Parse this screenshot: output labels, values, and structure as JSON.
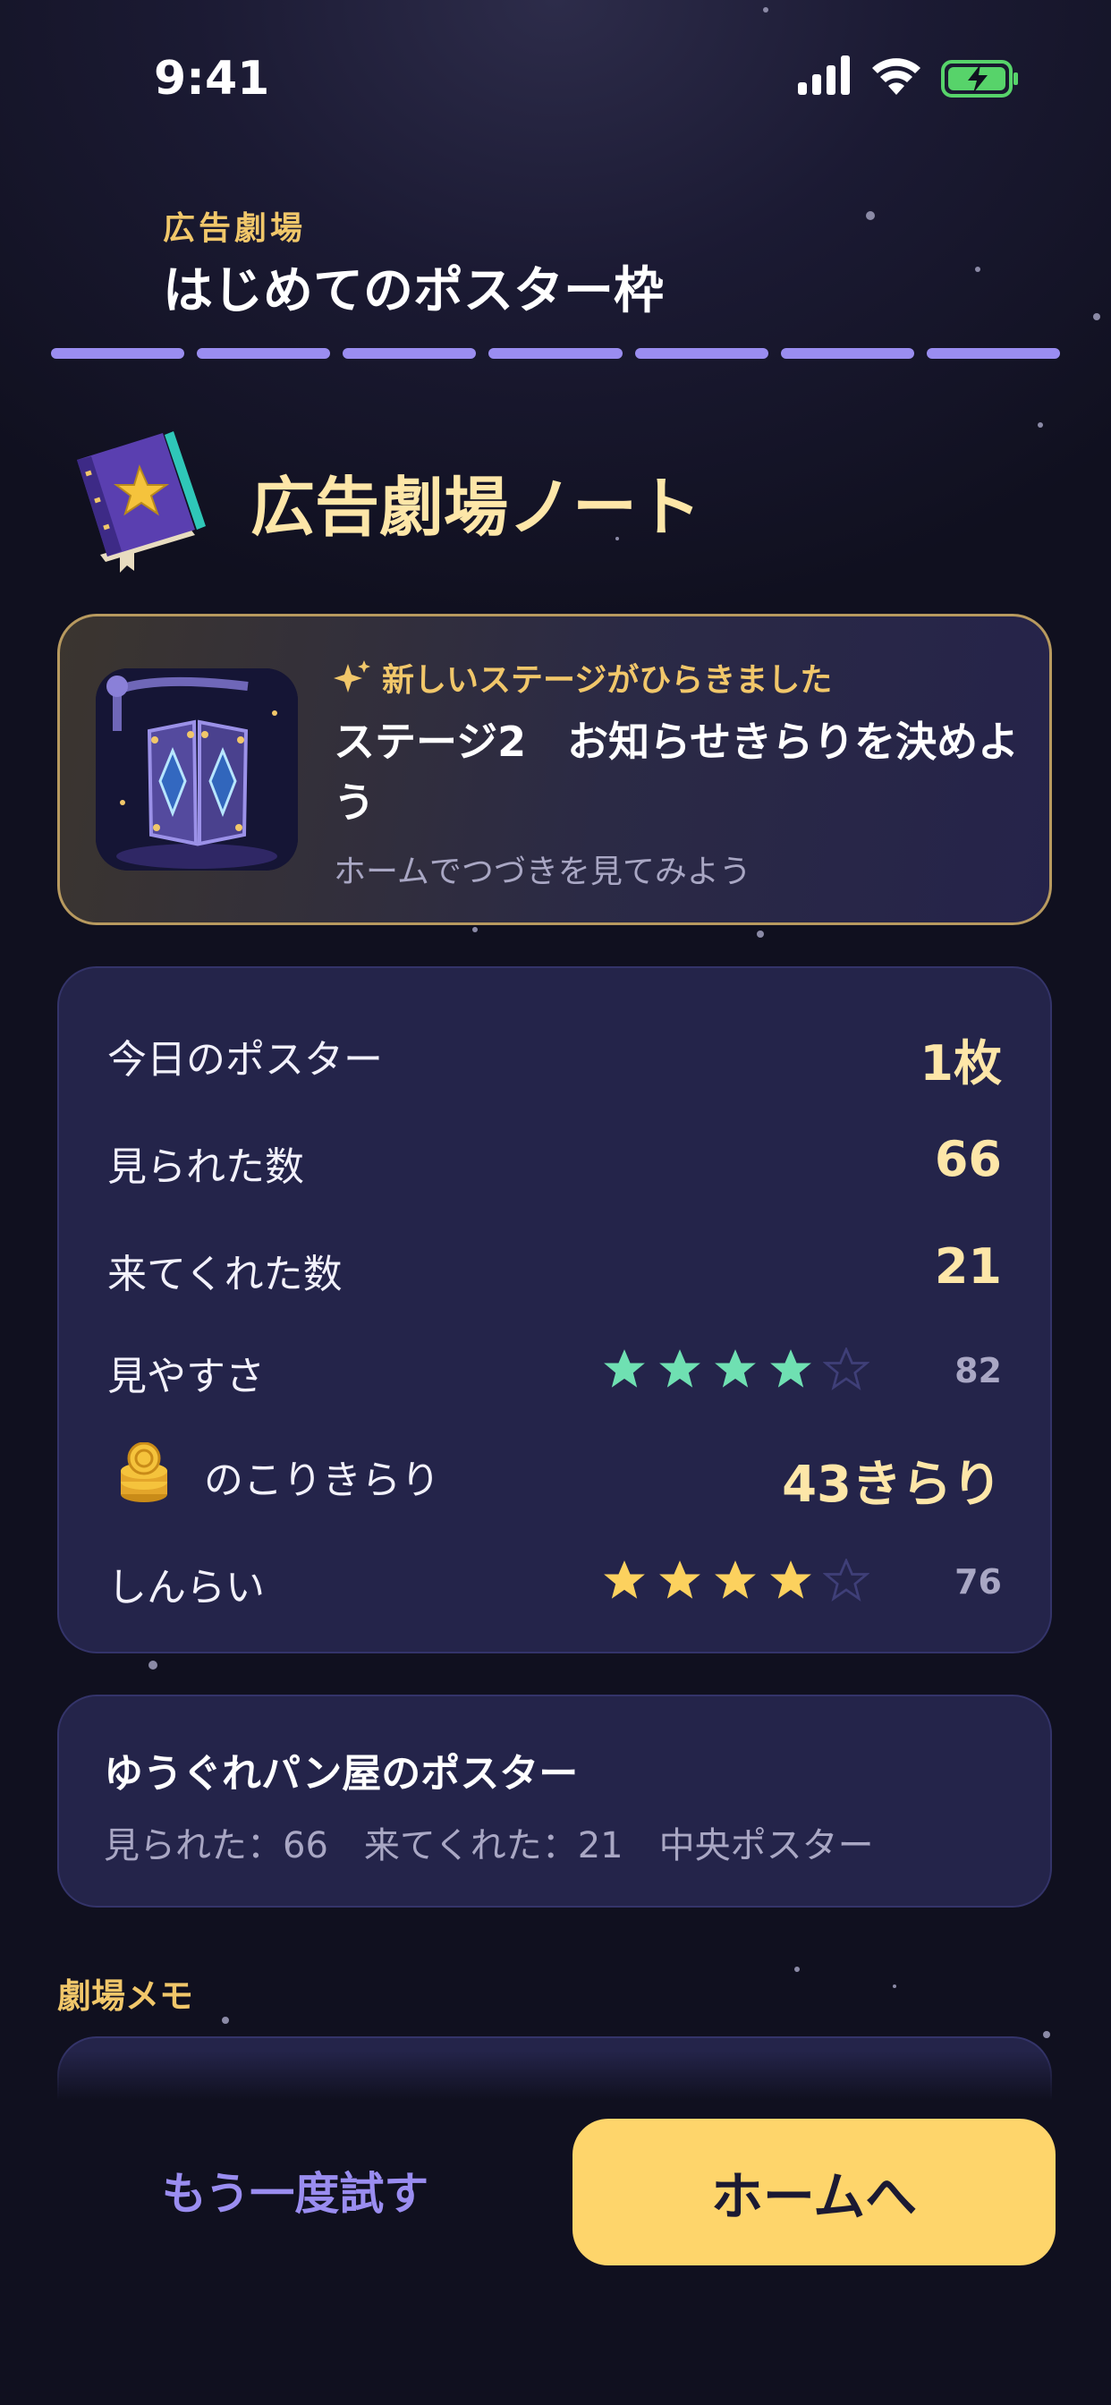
{
  "status_bar": {
    "time": "9:41"
  },
  "header": {
    "eyebrow": "広告劇場",
    "title": "はじめてのポスター枠"
  },
  "note": {
    "title": "広告劇場ノート"
  },
  "notice": {
    "tag": "新しいステージがひらきました",
    "title": "ステージ2　お知らせきらりを決めよう",
    "subtitle": "ホームでつづきを見てみよう"
  },
  "stats": {
    "today_posters": {
      "label": "今日のポスター",
      "value": "1枚"
    },
    "views": {
      "label": "見られた数",
      "value": "66"
    },
    "visits": {
      "label": "来てくれた数",
      "value": "21"
    },
    "readability": {
      "label": "見やすさ",
      "rating": 4,
      "max": 5,
      "score": "82"
    },
    "remaining": {
      "label": "のこりきらり",
      "value": "43きらり"
    },
    "trust": {
      "label": "しんらい",
      "rating": 4,
      "max": 5,
      "score": "76"
    }
  },
  "poster": {
    "title": "ゆうぐれパン屋のポスター",
    "meta": "見られた：66　来てくれた：21　中央ポスター"
  },
  "memo": {
    "label": "劇場メモ"
  },
  "actions": {
    "retry_label": "もう一度試す",
    "home_label": "ホームへ"
  },
  "colors": {
    "accent": "#9a8df0",
    "gold": "#f1c76a",
    "primary_button": "#fed56b",
    "green_star": "#6fe0b2",
    "yellow_star": "#fcd15e"
  }
}
